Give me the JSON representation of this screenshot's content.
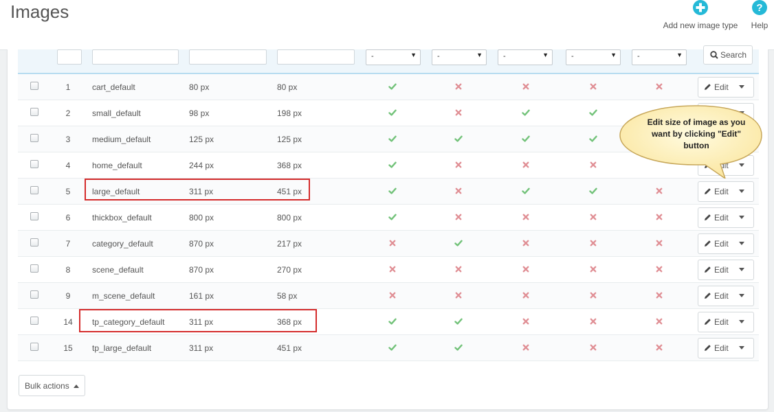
{
  "header": {
    "title": "Images",
    "add_label": "Add new image type",
    "help_label": "Help",
    "accent": "#25b9d7"
  },
  "filters": {
    "selects": [
      "-",
      "-",
      "-",
      "-",
      "-"
    ],
    "search_label": "Search"
  },
  "rows": [
    {
      "id": "1",
      "name": "cart_default",
      "width": "80 px",
      "height": "80 px",
      "marks": [
        true,
        false,
        false,
        false,
        false
      ]
    },
    {
      "id": "2",
      "name": "small_default",
      "width": "98 px",
      "height": "198 px",
      "marks": [
        true,
        false,
        true,
        true,
        null
      ]
    },
    {
      "id": "3",
      "name": "medium_default",
      "width": "125 px",
      "height": "125 px",
      "marks": [
        true,
        true,
        true,
        true,
        null
      ]
    },
    {
      "id": "4",
      "name": "home_default",
      "width": "244 px",
      "height": "368 px",
      "marks": [
        true,
        false,
        false,
        false,
        null
      ]
    },
    {
      "id": "5",
      "name": "large_default",
      "width": "311 px",
      "height": "451 px",
      "marks": [
        true,
        false,
        true,
        true,
        false
      ]
    },
    {
      "id": "6",
      "name": "thickbox_default",
      "width": "800 px",
      "height": "800 px",
      "marks": [
        true,
        false,
        false,
        false,
        false
      ]
    },
    {
      "id": "7",
      "name": "category_default",
      "width": "870 px",
      "height": "217 px",
      "marks": [
        false,
        true,
        false,
        false,
        false
      ]
    },
    {
      "id": "8",
      "name": "scene_default",
      "width": "870 px",
      "height": "270 px",
      "marks": [
        false,
        false,
        false,
        false,
        false
      ]
    },
    {
      "id": "9",
      "name": "m_scene_default",
      "width": "161 px",
      "height": "58 px",
      "marks": [
        false,
        false,
        false,
        false,
        false
      ]
    },
    {
      "id": "14",
      "name": "tp_category_default",
      "width": "311 px",
      "height": "368 px",
      "marks": [
        true,
        true,
        false,
        false,
        false
      ]
    },
    {
      "id": "15",
      "name": "tp_large_default",
      "width": "311 px",
      "height": "451 px",
      "marks": [
        true,
        true,
        false,
        false,
        false
      ]
    }
  ],
  "edit_label": "Edit",
  "bulk_label": "Bulk actions",
  "callout": {
    "text": "Edit size of image as you want by clicking \"Edit\" button"
  },
  "colors": {
    "check": "#72c279",
    "cross": "#e08f95",
    "highlight": "#d42b2b",
    "callout_fill": "#fdf3bd",
    "callout_stroke": "#c7a75a"
  }
}
